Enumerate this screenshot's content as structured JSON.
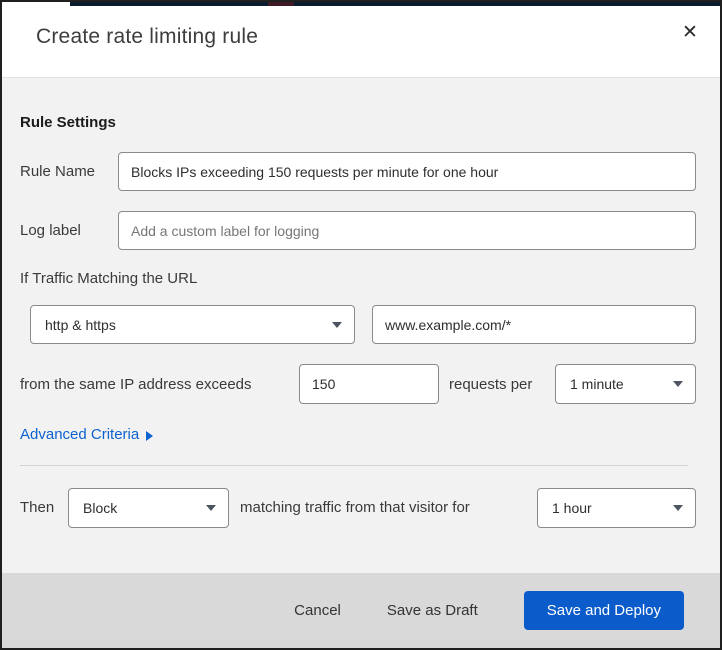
{
  "dialog": {
    "title": "Create rate limiting rule",
    "close_icon": "✕"
  },
  "colors": {
    "accent_blue": "#0b5cca",
    "link_blue": "#0d62d0",
    "body_bg": "#f2f2f2",
    "footer_bg": "#d9d9d9",
    "top_strip_navy": "#0a1d30",
    "top_strip_red": "#3f1a24"
  },
  "form": {
    "section_heading": "Rule Settings",
    "rule_name": {
      "label": "Rule Name",
      "value": "Blocks IPs exceeding 150 requests per minute for one hour"
    },
    "log_label": {
      "label": "Log label",
      "placeholder": "Add a custom label for logging"
    },
    "traffic_match": {
      "heading": "If Traffic Matching the URL",
      "scheme_selected": "http & https",
      "url_value": "www.example.com/*"
    },
    "threshold": {
      "prefix": "from the same IP address exceeds",
      "requests_value": "150",
      "middle": "requests per",
      "period_selected": "1 minute"
    },
    "advanced_criteria_label": "Advanced Criteria",
    "then": {
      "label": "Then",
      "action_selected": "Block",
      "middle": "matching traffic from that visitor for",
      "duration_selected": "1 hour"
    }
  },
  "footer": {
    "cancel_label": "Cancel",
    "save_draft_label": "Save as Draft",
    "save_deploy_label": "Save and Deploy"
  }
}
